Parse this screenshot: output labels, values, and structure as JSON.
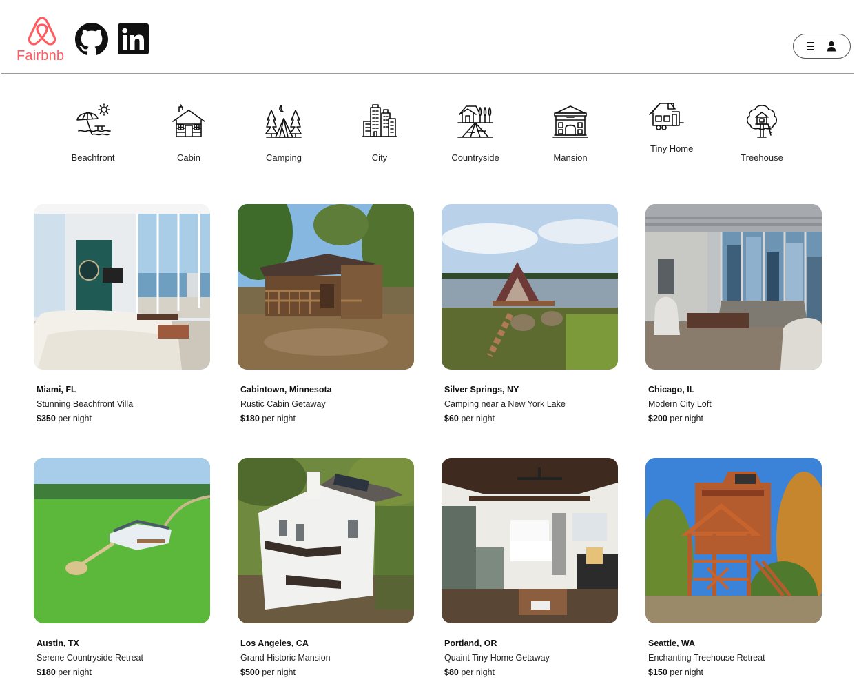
{
  "header": {
    "logo_text": "Fairbnb",
    "brand_color": "#FF5A5F",
    "links": [
      {
        "icon": "github-icon"
      },
      {
        "icon": "linkedin-icon"
      }
    ],
    "menu_icons": [
      "hamburger-menu-icon",
      "user-icon"
    ]
  },
  "categories": [
    {
      "label": "Beachfront",
      "icon": "beach-umbrella-icon"
    },
    {
      "label": "Cabin",
      "icon": "log-cabin-icon"
    },
    {
      "label": "Camping",
      "icon": "tent-icon"
    },
    {
      "label": "City",
      "icon": "city-buildings-icon"
    },
    {
      "label": "Countryside",
      "icon": "farmhouse-icon"
    },
    {
      "label": "Mansion",
      "icon": "mansion-icon"
    },
    {
      "label": "Tiny Home",
      "icon": "tiny-home-trailer-icon"
    },
    {
      "label": "Treehouse",
      "icon": "treehouse-icon"
    }
  ],
  "listings": [
    {
      "location": "Miami, FL",
      "title": "Stunning Beachfront Villa",
      "price": "$350",
      "per": "per night"
    },
    {
      "location": "Cabintown, Minnesota",
      "title": "Rustic Cabin Getaway",
      "price": "$180",
      "per": "per night"
    },
    {
      "location": "Silver Springs, NY",
      "title": "Camping near a New York Lake",
      "price": "$60",
      "per": "per night"
    },
    {
      "location": "Chicago, IL",
      "title": "Modern City Loft",
      "price": "$200",
      "per": "per night"
    },
    {
      "location": "Austin, TX",
      "title": "Serene Countryside Retreat",
      "price": "$180",
      "per": "per night"
    },
    {
      "location": "Los Angeles, CA",
      "title": "Grand Historic Mansion",
      "price": "$500",
      "per": "per night"
    },
    {
      "location": "Portland, OR",
      "title": "Quaint Tiny Home Getaway",
      "price": "$80",
      "per": "per night"
    },
    {
      "location": "Seattle, WA",
      "title": "Enchanting Treehouse Retreat",
      "price": "$150",
      "per": "per night"
    }
  ]
}
